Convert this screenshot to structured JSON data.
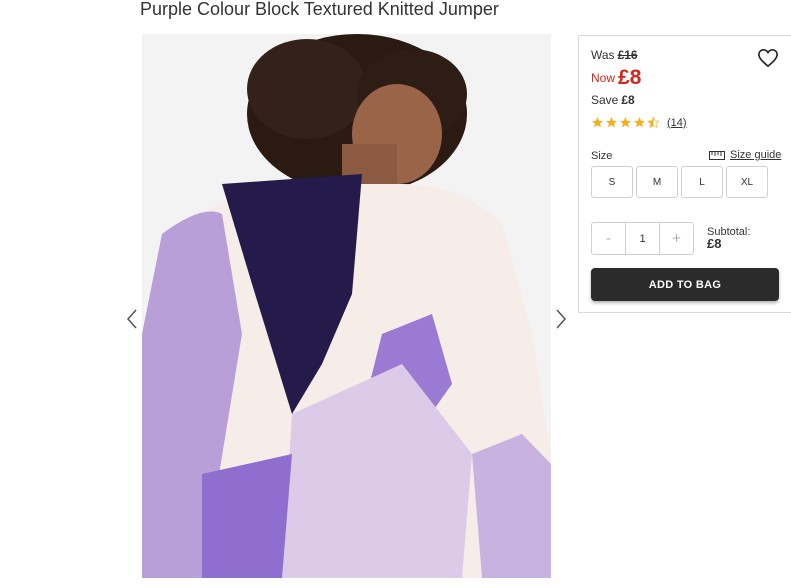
{
  "product": {
    "title": "Purple Colour Block Textured Knitted Jumper"
  },
  "pricing": {
    "was_label": "Was",
    "was_price": "£16",
    "now_label": "Now",
    "now_price": "£8",
    "save_label": "Save",
    "save_amount": "£8"
  },
  "rating": {
    "stars": 4.5,
    "reviews_count": "(14)"
  },
  "size": {
    "label": "Size",
    "guide_label": "Size guide",
    "options": [
      "S",
      "M",
      "L",
      "XL"
    ]
  },
  "quantity": {
    "minus": "-",
    "value": "1",
    "plus": "+"
  },
  "subtotal": {
    "label": "Subtotal:",
    "value": "£8"
  },
  "cart": {
    "add_label": "ADD TO BAG"
  },
  "colors": {
    "now_price": "#d4261c",
    "button_bg": "#2b2b2b",
    "star": "#f2b01e"
  },
  "icons": {
    "wishlist": "heart-icon",
    "size_guide": "ruler-icon",
    "prev": "chevron-left-icon",
    "next": "chevron-right-icon"
  }
}
